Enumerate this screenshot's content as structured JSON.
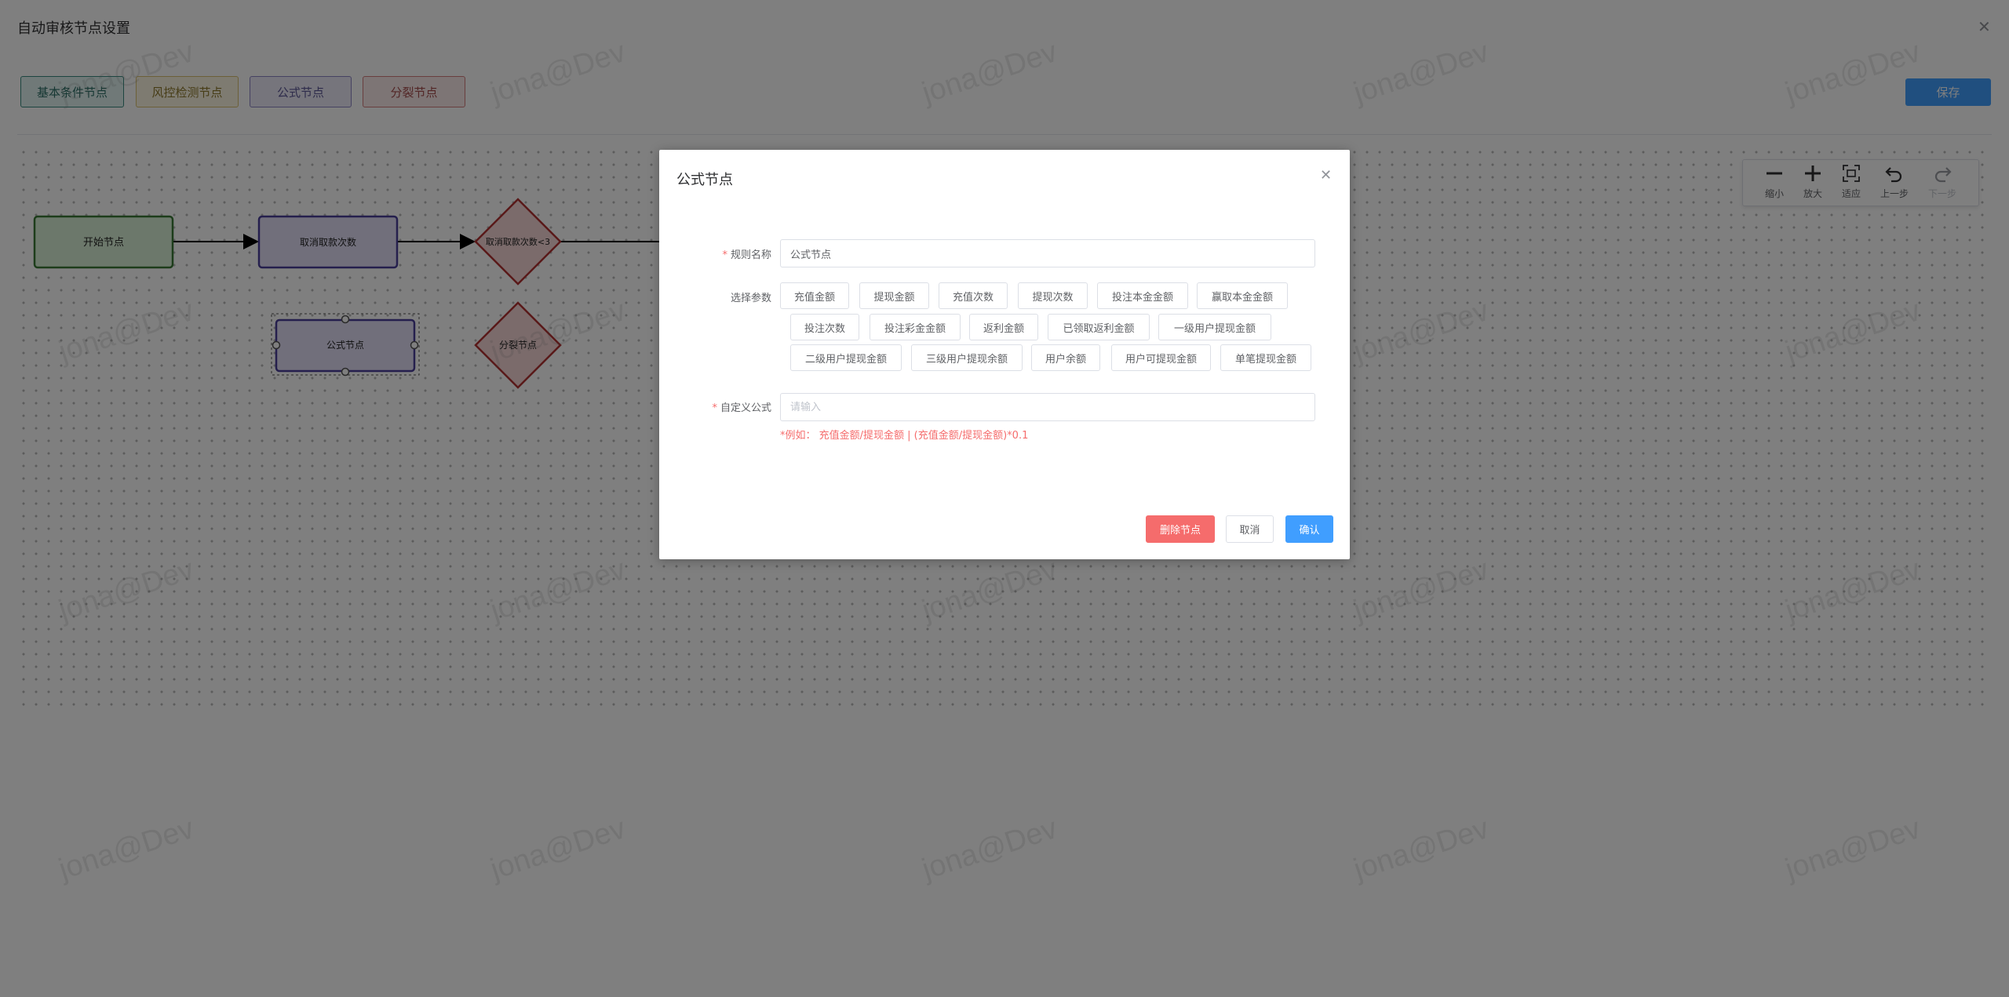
{
  "page": {
    "title": "自动审核节点设置",
    "save_label": "保存"
  },
  "palette": [
    {
      "label": "基本条件节点",
      "color": "#3a8a80"
    },
    {
      "label": "风控检测节点",
      "color": "#d8c070"
    },
    {
      "label": "公式节点",
      "color": "#8c84c4"
    },
    {
      "label": "分裂节点",
      "color": "#d27c7c"
    }
  ],
  "flow": {
    "start_node": "开始节点",
    "cancel_node": "取消取款次数",
    "decision_node": "取消取款次数<3",
    "formula_node": "公式节点",
    "split_node": "分裂节点"
  },
  "toolbar": [
    {
      "label": "缩小",
      "icon": "minus-icon"
    },
    {
      "label": "放大",
      "icon": "plus-icon"
    },
    {
      "label": "适应",
      "icon": "fit-icon"
    },
    {
      "label": "上一步",
      "icon": "undo-icon"
    },
    {
      "label": "下一步",
      "icon": "redo-icon"
    }
  ],
  "watermark": "jona@Dev",
  "modal": {
    "title": "公式节点",
    "rule_name_label": "规则名称",
    "rule_name_value": "公式节点",
    "params_label": "选择参数",
    "params": [
      "充值金额",
      "提现金额",
      "充值次数",
      "提现次数",
      "投注本金金额",
      "赢取本金金额",
      "投注次数",
      "投注彩金金额",
      "返利金额",
      "已领取返利金额",
      "一级用户提现金额",
      "二级用户提现金额",
      "三级用户提现余额",
      "用户余额",
      "用户可提现金额",
      "单笔提现金额"
    ],
    "formula_label": "自定义公式",
    "formula_placeholder": "请输入",
    "hint": "*例如： 充值金额/提现金额 | (充值金额/提现金额)*0.1",
    "delete_label": "删除节点",
    "cancel_label": "取消",
    "confirm_label": "确认"
  }
}
